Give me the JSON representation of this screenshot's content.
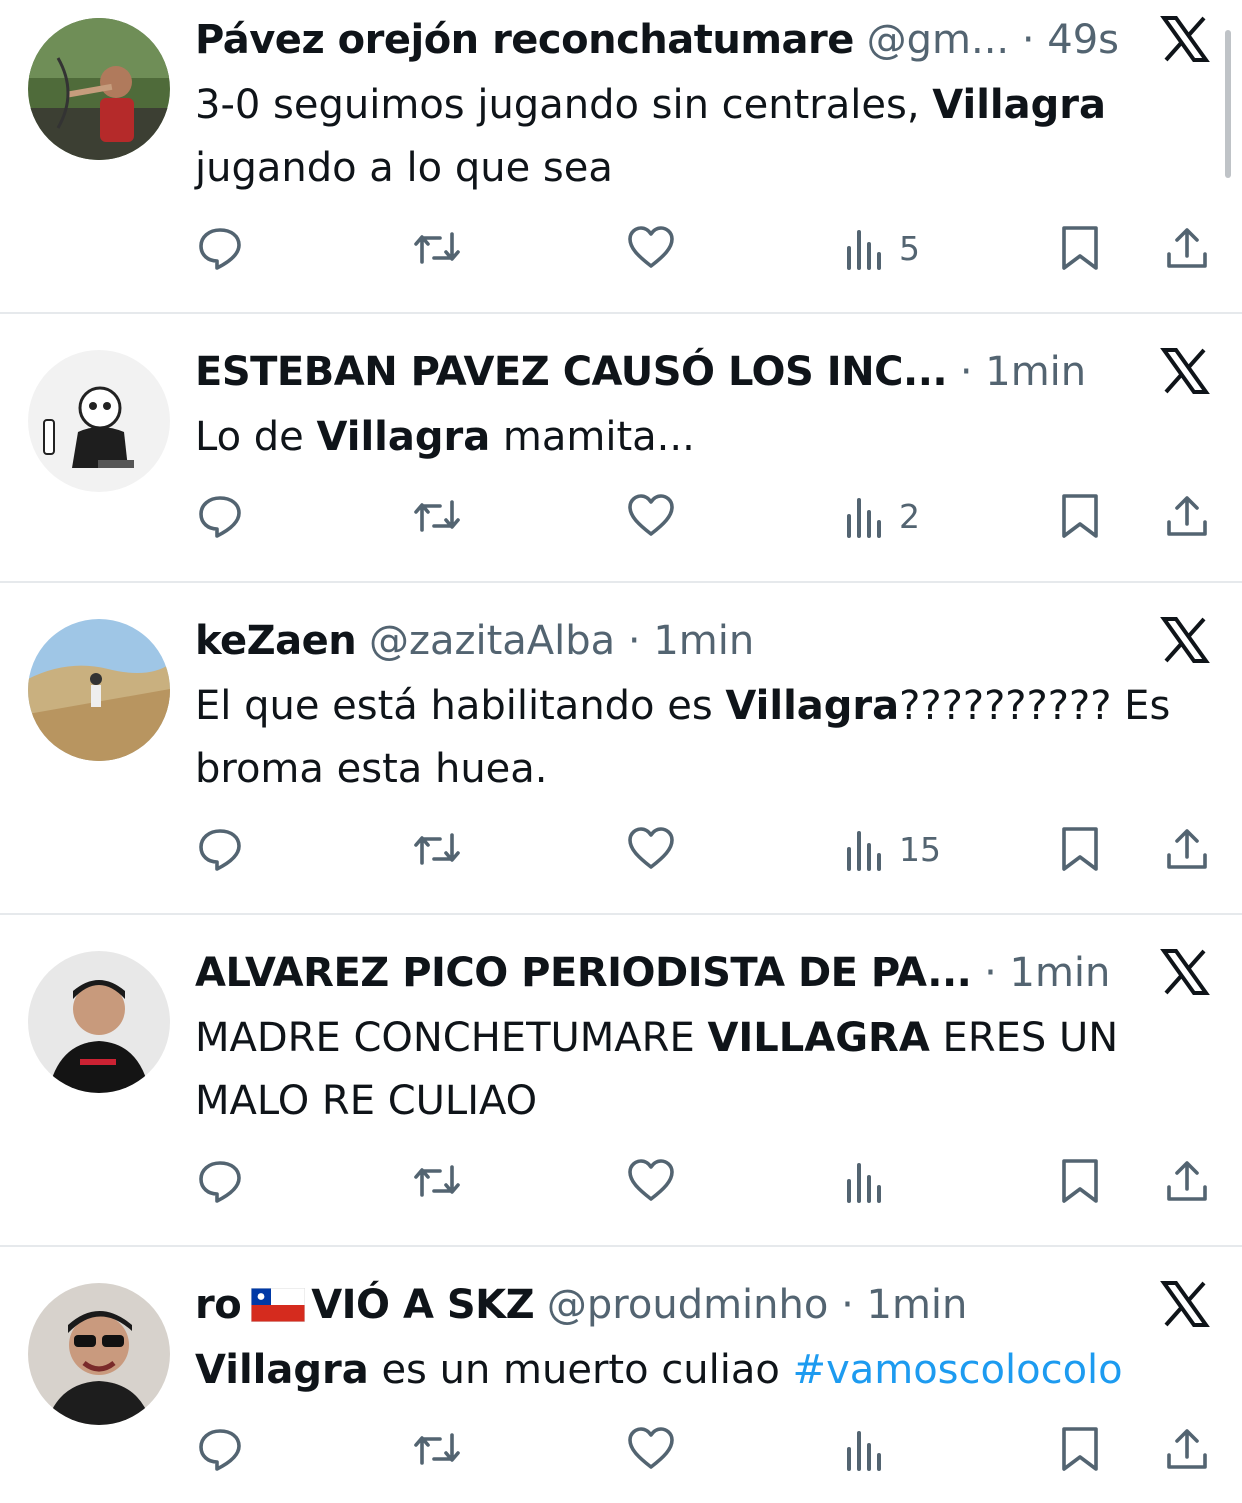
{
  "tweets": [
    {
      "name": "Pávez orejón reconchatumare",
      "handle": "@gm...",
      "sep": "·",
      "time": "49s",
      "text": [
        {
          "t": "3-0 seguimos jugando sin centrales, ",
          "b": false
        },
        {
          "t": "Villagra",
          "b": true
        },
        {
          "t": " jugando a lo que sea",
          "b": false
        }
      ],
      "views": "5"
    },
    {
      "name": "ESTEBAN PAVEZ CAUSÓ LOS INC...",
      "sep": "·",
      "time": "1min",
      "text": [
        {
          "t": "Lo de ",
          "b": false
        },
        {
          "t": "Villagra",
          "b": true
        },
        {
          "t": " mamita...",
          "b": false
        }
      ],
      "views": "2"
    },
    {
      "name": "keZaen",
      "handle": "@zazitaAlba",
      "sep": "·",
      "time": "1min",
      "text": [
        {
          "t": "El que está habilitando es ",
          "b": false
        },
        {
          "t": "Villagra",
          "b": true
        },
        {
          "t": "?????????? Es broma esta huea.",
          "b": false
        }
      ],
      "views": "15"
    },
    {
      "name": "ALVAREZ PICO PERIODISTA DE PA...",
      "sep": "·",
      "time": "1min",
      "text": [
        {
          "t": "MADRE CONCHETUMARE ",
          "b": false
        },
        {
          "t": "VILLAGRA",
          "b": true
        },
        {
          "t": " ERES UN MALO RE CULIAO",
          "b": false
        }
      ],
      "views": ""
    },
    {
      "name": "ro",
      "name_suffix": "VIÓ A SKZ",
      "flag_icon": "chile-flag-icon",
      "handle": "@proudminho",
      "sep": "·",
      "time": "1min",
      "text": [
        {
          "t": "Villagra",
          "b": true
        },
        {
          "t": " es un muerto culiao ",
          "b": false
        },
        {
          "t": "#vamoscolocolo",
          "b": false,
          "hashtag": true
        }
      ],
      "views": ""
    }
  ],
  "icons": [
    "reply-icon",
    "retweet-icon",
    "like-icon",
    "views-icon",
    "bookmark-icon",
    "share-icon",
    "x-logo-icon"
  ],
  "colors": {
    "text": "#0f1419",
    "muted": "#536471",
    "hashtag": "#1d9bf0",
    "divider": "#e6e9ec"
  }
}
